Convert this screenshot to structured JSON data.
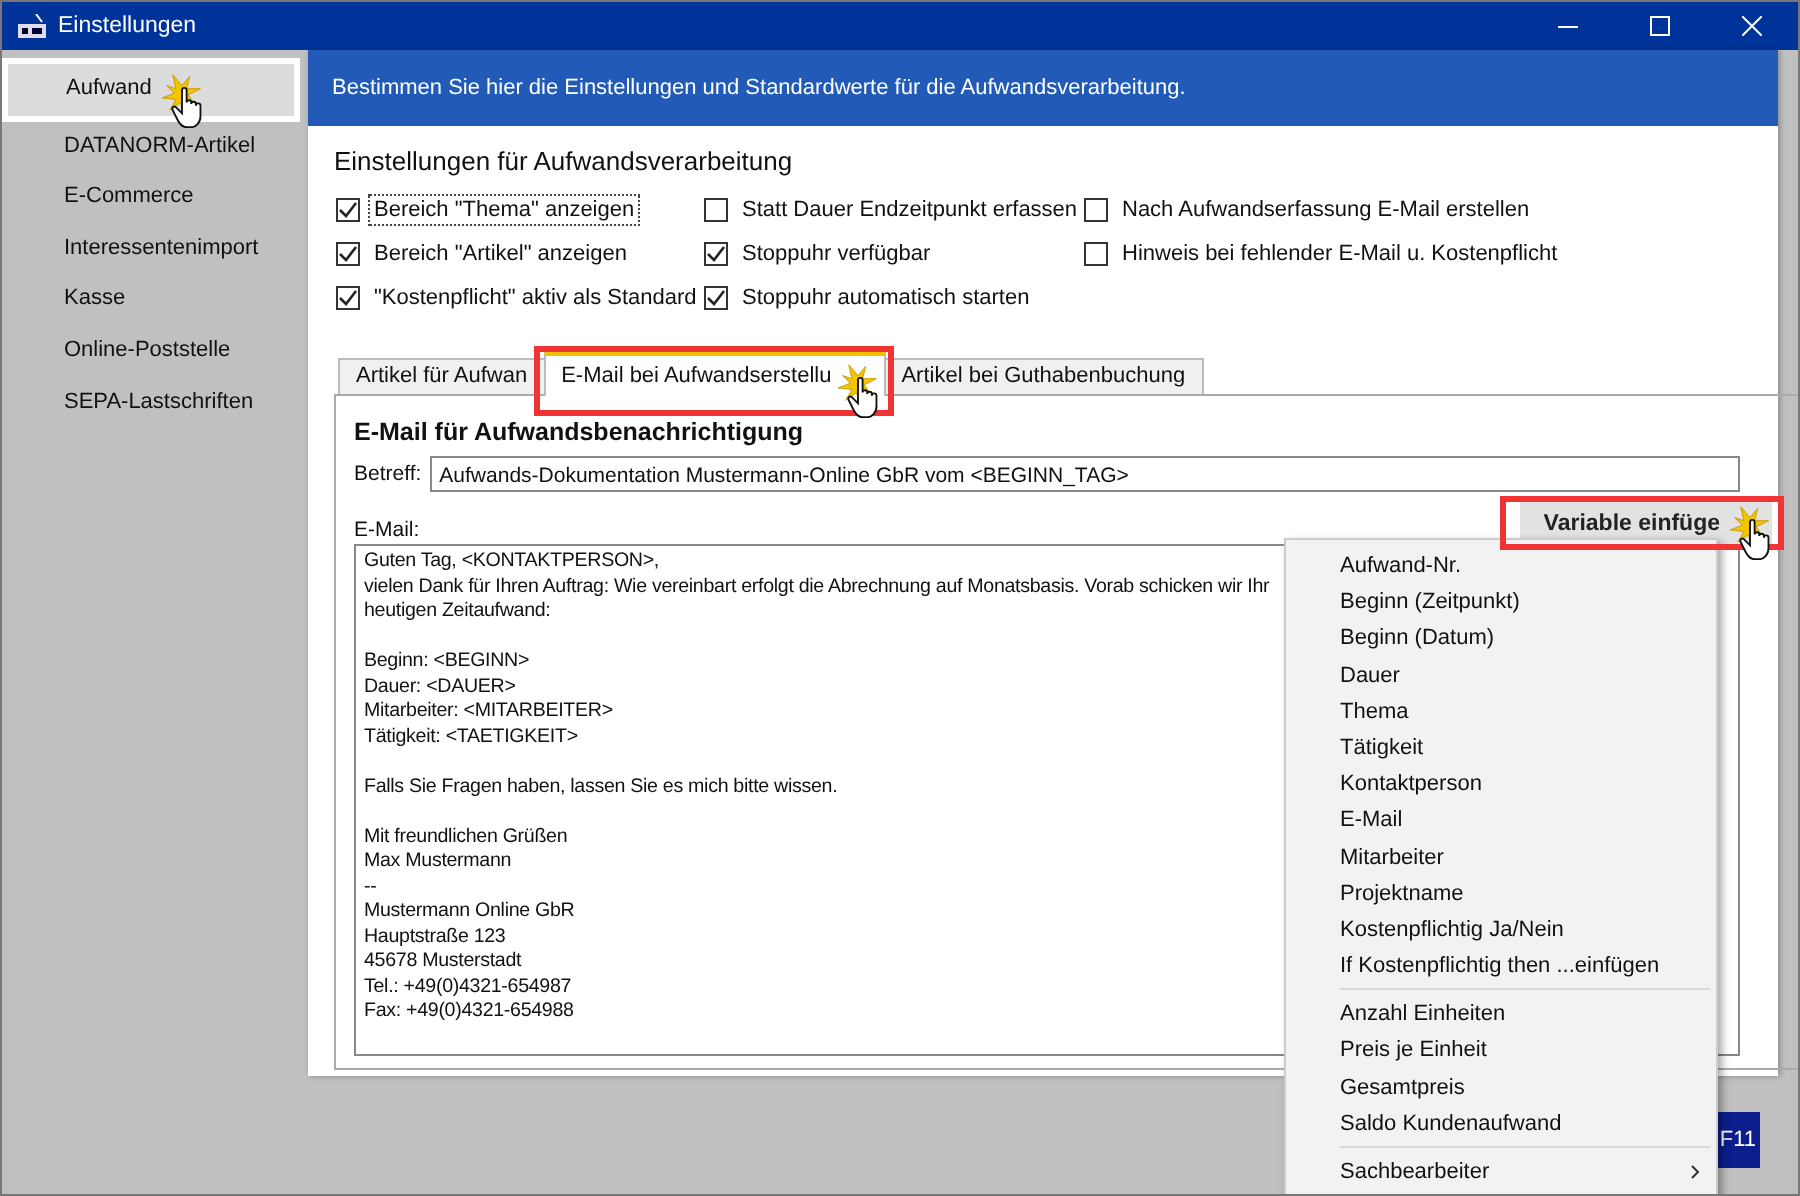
{
  "window": {
    "title": "Einstellungen"
  },
  "sidebar": {
    "items": [
      {
        "label": "Aufwand",
        "selected": true
      },
      {
        "label": "DATANORM-Artikel",
        "selected": false
      },
      {
        "label": "E-Commerce",
        "selected": false
      },
      {
        "label": "Interessentenimport",
        "selected": false
      },
      {
        "label": "Kasse",
        "selected": false
      },
      {
        "label": "Online-Poststelle",
        "selected": false
      },
      {
        "label": "SEPA-Lastschriften",
        "selected": false
      }
    ]
  },
  "header": {
    "text": "Bestimmen Sie hier die Einstellungen und Standardwerte für die Aufwandsverarbeitung."
  },
  "settings": {
    "title": "Einstellungen für Aufwandsverarbeitung",
    "options": [
      {
        "label": "Bereich \"Thema\" anzeigen",
        "checked": true,
        "focused": true
      },
      {
        "label": "Statt Dauer Endzeitpunkt erfassen",
        "checked": false,
        "focused": false
      },
      {
        "label": "Nach Aufwandserfassung E-Mail erstellen",
        "checked": false,
        "focused": false
      },
      {
        "label": "Bereich \"Artikel\" anzeigen",
        "checked": true,
        "focused": false
      },
      {
        "label": "Stoppuhr verfügbar",
        "checked": true,
        "focused": false
      },
      {
        "label": "Hinweis bei fehlender E-Mail u. Kostenpflicht",
        "checked": false,
        "focused": false
      },
      {
        "label": "\"Kostenpflicht\" aktiv als Standard",
        "checked": true,
        "focused": false
      },
      {
        "label": "Stoppuhr automatisch starten",
        "checked": true,
        "focused": false
      }
    ]
  },
  "tabs": [
    {
      "label": "Artikel für Aufwan",
      "selected": false
    },
    {
      "label": "E-Mail bei Aufwandserstellu",
      "selected": true
    },
    {
      "label": "Artikel bei Guthabenbuchung",
      "selected": false
    }
  ],
  "email": {
    "heading": "E-Mail für Aufwandsbenachrichtigung",
    "subject_label": "Betreff:",
    "subject": "Aufwands-Dokumentation Mustermann-Online GbR vom <BEGINN_TAG>",
    "body_label": "E-Mail:",
    "body": "Guten Tag, <KONTAKTPERSON>,\nvielen Dank für Ihren Auftrag: Wie vereinbart erfolgt die Abrechnung auf Monatsbasis. Vorab schicken wir Ihr\nheutigen Zeitaufwand:\n\nBeginn: <BEGINN>\nDauer: <DAUER>\nMitarbeiter: <MITARBEITER>\nTätigkeit: <TAETIGKEIT>\n\nFalls Sie Fragen haben, lassen Sie es mich bitte wissen.\n\nMit freundlichen Grüßen\nMax Mustermann\n--\nMustermann Online GbR\nHauptstraße 123\n45678 Musterstadt\nTel.: +49(0)4321-654987\nFax: +49(0)4321-654988"
  },
  "insert_button": {
    "label": "Variable einfüge"
  },
  "menu": {
    "groups": [
      [
        {
          "label": "Aufwand-Nr.",
          "kind": "item"
        },
        {
          "label": "Beginn (Zeitpunkt)",
          "kind": "item"
        },
        {
          "label": "Beginn (Datum)",
          "kind": "item"
        },
        {
          "label": "Dauer",
          "kind": "item"
        },
        {
          "label": "Thema",
          "kind": "item"
        },
        {
          "label": "Tätigkeit",
          "kind": "item"
        },
        {
          "label": "Kontaktperson",
          "kind": "item"
        },
        {
          "label": "E-Mail",
          "kind": "item"
        },
        {
          "label": "Mitarbeiter",
          "kind": "item"
        },
        {
          "label": "Projektname",
          "kind": "item"
        },
        {
          "label": "Kostenpflichtig Ja/Nein",
          "kind": "item"
        },
        {
          "label": "If Kostenpflichtig then ...einfügen",
          "kind": "item"
        }
      ],
      [
        {
          "label": "Anzahl Einheiten",
          "kind": "item"
        },
        {
          "label": "Preis je Einheit",
          "kind": "item"
        },
        {
          "label": "Gesamtpreis",
          "kind": "item"
        },
        {
          "label": "Saldo Kundenaufwand",
          "kind": "item"
        }
      ],
      [
        {
          "label": "Sachbearbeiter",
          "kind": "submenu"
        }
      ]
    ]
  },
  "function_key": {
    "label": "F11"
  }
}
